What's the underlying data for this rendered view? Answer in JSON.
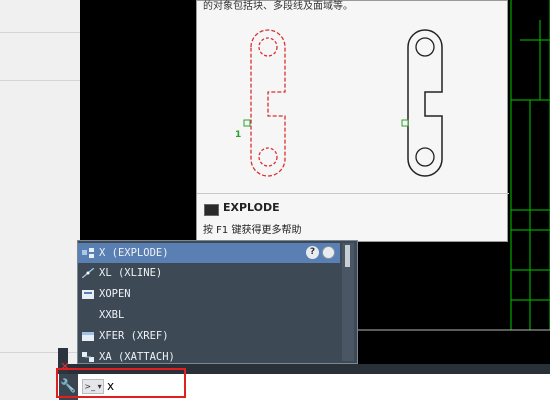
{
  "tooltip": {
    "description": "的对象包括块、多段线及面域等。",
    "callout_label": "1",
    "command_name": "EXPLODE",
    "help_hint": "按 F1 键获得更多帮助"
  },
  "autocomplete": {
    "items": [
      {
        "label": "X (EXPLODE)",
        "icon": "explode-icon",
        "selected": true
      },
      {
        "label": "XL (XLINE)",
        "icon": "xline-icon"
      },
      {
        "label": "XOPEN",
        "icon": "xopen-icon"
      },
      {
        "label": "XXBL",
        "icon": ""
      },
      {
        "label": "XFER (XREF)",
        "icon": "xref-icon"
      },
      {
        "label": "XA (XATTACH)",
        "icon": "xattach-icon"
      }
    ],
    "help_button": "?",
    "web_button": "web-help-icon"
  },
  "command_line": {
    "prompt_glyph": ">_ ▾",
    "value": "x"
  },
  "colors": {
    "selection": "#5a7fb3",
    "list_bg": "#3d4954",
    "highlight": "#e02020",
    "cad_green": "#00c800"
  }
}
